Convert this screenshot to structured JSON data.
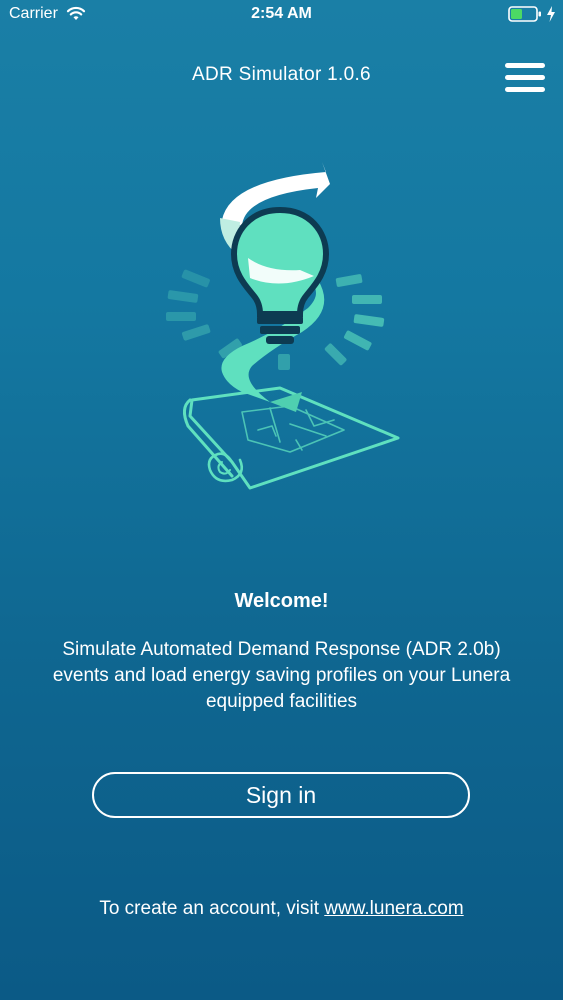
{
  "status_bar": {
    "carrier": "Carrier",
    "time": "2:54 AM",
    "icons": [
      "wifi-icon",
      "battery-icon",
      "charging-icon"
    ]
  },
  "nav": {
    "title": "ADR Simulator 1.0.6",
    "menu_icon": "hamburger-menu-icon"
  },
  "hero": {
    "icon": "lightbulb-blueprint-illustration"
  },
  "welcome": {
    "heading": "Welcome!",
    "description": "Simulate Automated Demand Response (ADR 2.0b) events and load energy saving profiles on your Lunera equipped facilities"
  },
  "actions": {
    "sign_in_label": "Sign in"
  },
  "footer": {
    "prefix": "To create an account, visit ",
    "link_text": "www.lunera.com"
  },
  "colors": {
    "background_top": "#1a7fa6",
    "background_bottom": "#0b5a86",
    "accent_mint": "#5fe0bf",
    "bulb_outline": "#0d3b52",
    "text": "#ffffff"
  }
}
